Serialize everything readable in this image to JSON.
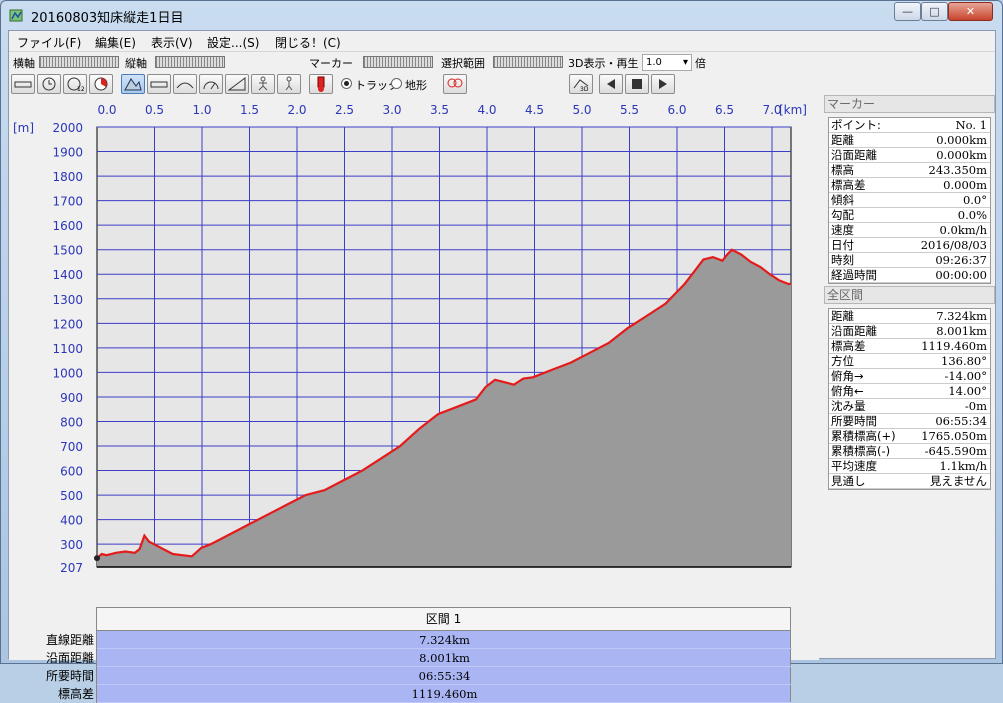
{
  "window": {
    "title": "20160803知床縦走1日目",
    "min": "—",
    "max": "□",
    "close": "✕"
  },
  "menu": [
    "ファイル(F)",
    "編集(E)",
    "表示(V)",
    "設定...(S)",
    "閉じる！(C)"
  ],
  "toolbar": {
    "yokojiku": "横軸",
    "tatejiku": "縦軸",
    "marker": "マーカー",
    "range": "選択範囲",
    "play3d": "3D表示・再生",
    "speed": "1.0",
    "bai": "倍",
    "track": "トラック",
    "terrain": "地形",
    "track_selected": true
  },
  "chart_data": {
    "type": "area",
    "xlabel": "[km]",
    "ylabel": "[m]",
    "xlim": [
      0,
      7.324
    ],
    "ylim": [
      207,
      2000
    ],
    "xticks": [
      "0.0",
      "0.5",
      "1.0",
      "1.5",
      "2.0",
      "2.5",
      "3.0",
      "3.5",
      "4.0",
      "4.5",
      "5.0",
      "5.5",
      "6.0",
      "6.5",
      "7.0"
    ],
    "yticks": [
      "2000",
      "1900",
      "1800",
      "1700",
      "1600",
      "1500",
      "1400",
      "1300",
      "1200",
      "1100",
      "1000",
      "900",
      "800",
      "700",
      "600",
      "500",
      "400",
      "300",
      "207"
    ],
    "grid": true,
    "series": [
      {
        "color": "#e41b1b",
        "x": [
          0,
          0.05,
          0.1,
          0.2,
          0.3,
          0.4,
          0.45,
          0.5,
          0.55,
          0.6,
          0.7,
          0.8,
          0.9,
          1.0,
          1.1,
          1.2,
          1.4,
          1.6,
          1.8,
          2.0,
          2.2,
          2.4,
          2.6,
          2.8,
          3.0,
          3.2,
          3.4,
          3.6,
          3.8,
          4.0,
          4.1,
          4.2,
          4.3,
          4.4,
          4.5,
          4.6,
          4.8,
          5.0,
          5.2,
          5.4,
          5.6,
          5.8,
          6.0,
          6.1,
          6.2,
          6.3,
          6.4,
          6.5,
          6.6,
          6.65,
          6.7,
          6.8,
          6.9,
          7.0,
          7.1,
          7.2,
          7.3,
          7.324
        ],
        "y": [
          243,
          260,
          255,
          265,
          270,
          265,
          280,
          335,
          310,
          300,
          280,
          260,
          255,
          250,
          285,
          300,
          340,
          380,
          420,
          460,
          500,
          520,
          560,
          600,
          650,
          700,
          770,
          830,
          860,
          890,
          940,
          970,
          960,
          950,
          975,
          980,
          1010,
          1040,
          1080,
          1120,
          1180,
          1230,
          1280,
          1320,
          1360,
          1410,
          1460,
          1470,
          1455,
          1480,
          1500,
          1480,
          1450,
          1430,
          1400,
          1375,
          1360,
          1362
        ]
      }
    ]
  },
  "marker": {
    "header": "マーカー",
    "rows": [
      {
        "k": "ポイント:",
        "v": "No. 1"
      },
      {
        "k": "距離",
        "v": "0.000km"
      },
      {
        "k": "沿面距離",
        "v": "0.000km"
      },
      {
        "k": "標高",
        "v": "243.350m"
      },
      {
        "k": "標高差",
        "v": "0.000m"
      },
      {
        "k": "傾斜",
        "v": "0.0°"
      },
      {
        "k": "勾配",
        "v": "0.0%"
      },
      {
        "k": "速度",
        "v": "0.0km/h"
      },
      {
        "k": "日付",
        "v": "2016/08/03"
      },
      {
        "k": "時刻",
        "v": "09:26:37"
      },
      {
        "k": "経過時間",
        "v": "00:00:00"
      }
    ]
  },
  "whole": {
    "header": "全区間",
    "rows": [
      {
        "k": "距離",
        "v": "7.324km"
      },
      {
        "k": "沿面距離",
        "v": "8.001km"
      },
      {
        "k": "標高差",
        "v": "1119.460m"
      },
      {
        "k": "方位",
        "v": "136.80°"
      },
      {
        "k": "俯角→",
        "v": "-14.00°"
      },
      {
        "k": "俯角←",
        "v": "14.00°"
      },
      {
        "k": "沈み量",
        "v": "-0m"
      },
      {
        "k": "所要時間",
        "v": "06:55:34"
      },
      {
        "k": "累積標高(+)",
        "v": "1765.050m"
      },
      {
        "k": "累積標高(-)",
        "v": "-645.590m"
      },
      {
        "k": "平均速度",
        "v": "1.1km/h"
      },
      {
        "k": "見通し",
        "v": "見えません"
      }
    ]
  },
  "section": {
    "header": "区間 1",
    "labels": [
      "直線距離",
      "沿面距離",
      "所要時間",
      "標高差"
    ],
    "values": [
      "7.324km",
      "8.001km",
      "06:55:34",
      "1119.460m"
    ]
  }
}
